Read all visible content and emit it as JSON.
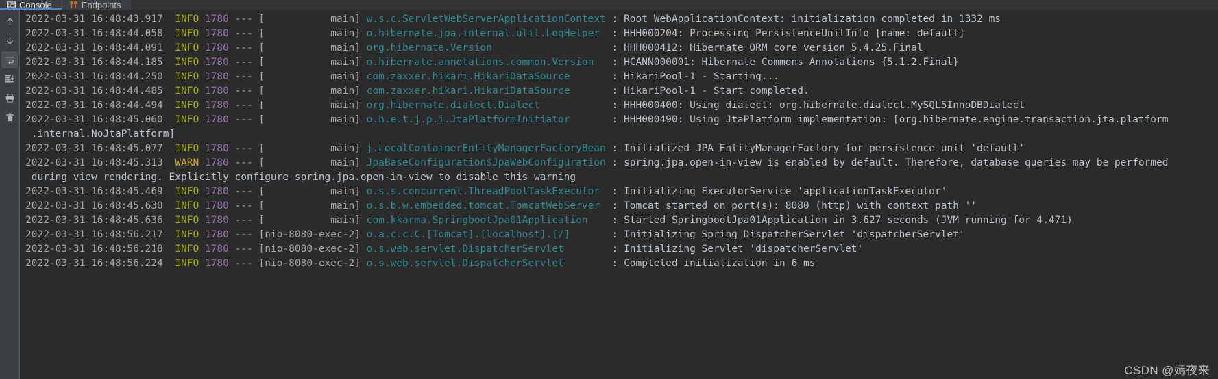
{
  "window": {
    "background_color": "#2b2b2b",
    "panel_color": "#3c3f41"
  },
  "tabs": {
    "items": [
      {
        "label": "Console",
        "icon": "console-icon",
        "active": true
      },
      {
        "label": "Endpoints",
        "icon": "endpoints-icon",
        "active": false
      }
    ],
    "active_indicator_color": "#4a88c7"
  },
  "gutter": {
    "items": [
      {
        "name": "up-arrow-icon",
        "label": "Up the Stack Trace",
        "selected": false
      },
      {
        "name": "down-arrow-icon",
        "label": "Down the Stack Trace",
        "selected": false
      },
      {
        "name": "soft-wrap-icon",
        "label": "Soft-Wrap",
        "selected": true
      },
      {
        "name": "scroll-to-end-icon",
        "label": "Scroll to End",
        "selected": false
      },
      {
        "name": "print-icon",
        "label": "Print",
        "selected": false
      },
      {
        "name": "trash-icon",
        "label": "Clear All",
        "selected": false
      }
    ]
  },
  "console": {
    "colors": {
      "timestamp": "#a6a6a6",
      "info": "#a5b512",
      "warn": "#cfa82c",
      "pid": "#9876aa",
      "logger": "#2e8a8f",
      "message": "#b8c0c8"
    },
    "lines": [
      {
        "type": "log",
        "time": "2022-03-31 16:48:43.917",
        "level": "INFO",
        "pid": "1780",
        "sep": "---",
        "thread": "[           main]",
        "logger": "w.s.c.ServletWebServerApplicationContext",
        "colon": ":",
        "message": "Root WebApplicationContext: initialization completed in 1332 ms"
      },
      {
        "type": "log",
        "time": "2022-03-31 16:48:44.058",
        "level": "INFO",
        "pid": "1780",
        "sep": "---",
        "thread": "[           main]",
        "logger": "o.hibernate.jpa.internal.util.LogHelper",
        "colon": ":",
        "message": "HHH000204: Processing PersistenceUnitInfo [name: default]"
      },
      {
        "type": "log",
        "time": "2022-03-31 16:48:44.091",
        "level": "INFO",
        "pid": "1780",
        "sep": "---",
        "thread": "[           main]",
        "logger": "org.hibernate.Version",
        "colon": ":",
        "message": "HHH000412: Hibernate ORM core version 5.4.25.Final"
      },
      {
        "type": "log",
        "time": "2022-03-31 16:48:44.185",
        "level": "INFO",
        "pid": "1780",
        "sep": "---",
        "thread": "[           main]",
        "logger": "o.hibernate.annotations.common.Version",
        "colon": ":",
        "message": "HCANN000001: Hibernate Commons Annotations {5.1.2.Final}"
      },
      {
        "type": "log",
        "time": "2022-03-31 16:48:44.250",
        "level": "INFO",
        "pid": "1780",
        "sep": "---",
        "thread": "[           main]",
        "logger": "com.zaxxer.hikari.HikariDataSource",
        "colon": ":",
        "message": "HikariPool-1 - Starting..."
      },
      {
        "type": "log",
        "time": "2022-03-31 16:48:44.485",
        "level": "INFO",
        "pid": "1780",
        "sep": "---",
        "thread": "[           main]",
        "logger": "com.zaxxer.hikari.HikariDataSource",
        "colon": ":",
        "message": "HikariPool-1 - Start completed."
      },
      {
        "type": "log",
        "time": "2022-03-31 16:48:44.494",
        "level": "INFO",
        "pid": "1780",
        "sep": "---",
        "thread": "[           main]",
        "logger": "org.hibernate.dialect.Dialect",
        "colon": ":",
        "message": "HHH000400: Using dialect: org.hibernate.dialect.MySQL5InnoDBDialect"
      },
      {
        "type": "log",
        "time": "2022-03-31 16:48:45.060",
        "level": "INFO",
        "pid": "1780",
        "sep": "---",
        "thread": "[           main]",
        "logger": "o.h.e.t.j.p.i.JtaPlatformInitiator",
        "colon": ":",
        "message": "HHH000490: Using JtaPlatform implementation: [org.hibernate.engine.transaction.jta.platform"
      },
      {
        "type": "continuation",
        "text": " .internal.NoJtaPlatform]"
      },
      {
        "type": "log",
        "time": "2022-03-31 16:48:45.077",
        "level": "INFO",
        "pid": "1780",
        "sep": "---",
        "thread": "[           main]",
        "logger": "j.LocalContainerEntityManagerFactoryBean",
        "colon": ":",
        "message": "Initialized JPA EntityManagerFactory for persistence unit 'default'"
      },
      {
        "type": "log",
        "time": "2022-03-31 16:48:45.313",
        "level": "WARN",
        "pid": "1780",
        "sep": "---",
        "thread": "[           main]",
        "logger": "JpaBaseConfiguration$JpaWebConfiguration",
        "colon": ":",
        "message": "spring.jpa.open-in-view is enabled by default. Therefore, database queries may be performed"
      },
      {
        "type": "continuation",
        "text": " during view rendering. Explicitly configure spring.jpa.open-in-view to disable this warning"
      },
      {
        "type": "log",
        "time": "2022-03-31 16:48:45.469",
        "level": "INFO",
        "pid": "1780",
        "sep": "---",
        "thread": "[           main]",
        "logger": "o.s.s.concurrent.ThreadPoolTaskExecutor",
        "colon": ":",
        "message": "Initializing ExecutorService 'applicationTaskExecutor'"
      },
      {
        "type": "log",
        "time": "2022-03-31 16:48:45.630",
        "level": "INFO",
        "pid": "1780",
        "sep": "---",
        "thread": "[           main]",
        "logger": "o.s.b.w.embedded.tomcat.TomcatWebServer",
        "colon": ":",
        "message": "Tomcat started on port(s): 8080 (http) with context path ''"
      },
      {
        "type": "log",
        "time": "2022-03-31 16:48:45.636",
        "level": "INFO",
        "pid": "1780",
        "sep": "---",
        "thread": "[           main]",
        "logger": "com.kkarma.SpringbootJpa01Application",
        "colon": ":",
        "message": "Started SpringbootJpa01Application in 3.627 seconds (JVM running for 4.471)"
      },
      {
        "type": "log",
        "time": "2022-03-31 16:48:56.217",
        "level": "INFO",
        "pid": "1780",
        "sep": "---",
        "thread": "[nio-8080-exec-2]",
        "logger": "o.a.c.c.C.[Tomcat].[localhost].[/]",
        "colon": ":",
        "message": "Initializing Spring DispatcherServlet 'dispatcherServlet'"
      },
      {
        "type": "log",
        "time": "2022-03-31 16:48:56.218",
        "level": "INFO",
        "pid": "1780",
        "sep": "---",
        "thread": "[nio-8080-exec-2]",
        "logger": "o.s.web.servlet.DispatcherServlet",
        "colon": ":",
        "message": "Initializing Servlet 'dispatcherServlet'"
      },
      {
        "type": "log",
        "time": "2022-03-31 16:48:56.224",
        "level": "INFO",
        "pid": "1780",
        "sep": "---",
        "thread": "[nio-8080-exec-2]",
        "logger": "o.s.web.servlet.DispatcherServlet",
        "colon": ":",
        "message": "Completed initialization in 6 ms"
      }
    ]
  },
  "watermark": {
    "text": "CSDN @嫣夜来"
  }
}
